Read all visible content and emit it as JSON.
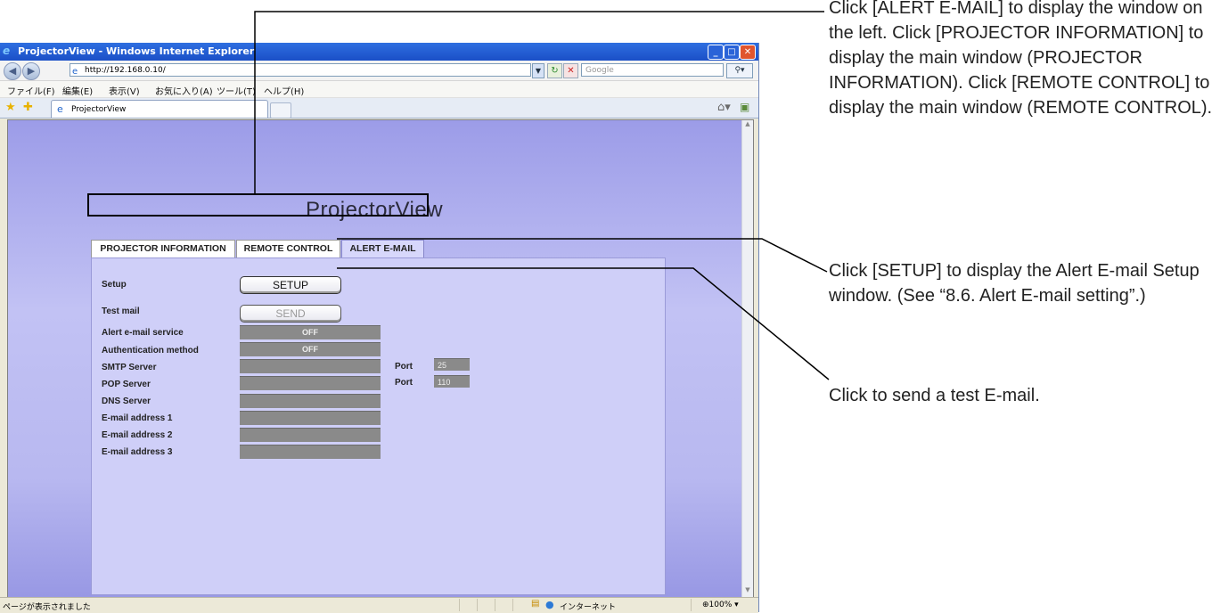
{
  "browser": {
    "title": "ProjectorView - Windows Internet Explorer",
    "url": "http://192.168.0.10/",
    "search_placeholder": "Google",
    "menu": [
      "ファイル(F)",
      "編集(E)",
      "表示(V)",
      "お気に入り(A)",
      "ツール(T)",
      "ヘルプ(H)"
    ],
    "tab_label": "ProjectorView",
    "status_text": "ページが表示されました",
    "zone_text": "インターネット",
    "zoom_text": "100%"
  },
  "app": {
    "title": "ProjectorView",
    "tabs": [
      {
        "label": "PROJECTOR INFORMATION",
        "selected": false
      },
      {
        "label": "REMOTE CONTROL",
        "selected": false
      },
      {
        "label": "ALERT E-MAIL",
        "selected": true
      }
    ],
    "setup_label": "Setup",
    "setup_button": "SETUP",
    "testmail_label": "Test mail",
    "send_button": "SEND",
    "fields": {
      "alert_service": {
        "label": "Alert e-mail service",
        "value": "OFF"
      },
      "auth_method": {
        "label": "Authentication method",
        "value": "OFF"
      },
      "smtp": {
        "label": "SMTP Server",
        "value": "",
        "port_label": "Port",
        "port": "25"
      },
      "pop": {
        "label": "POP Server",
        "value": "",
        "port_label": "Port",
        "port": "110"
      },
      "dns": {
        "label": "DNS Server",
        "value": ""
      },
      "email1": {
        "label": "E-mail address 1",
        "value": ""
      },
      "email2": {
        "label": "E-mail address 2",
        "value": ""
      },
      "email3": {
        "label": "E-mail address 3",
        "value": ""
      }
    }
  },
  "annotations": {
    "alert_tab": "Click [ALERT E-MAIL] to display the window on the left. Click [PROJECTOR INFORMATION] to display the main window (PROJECTOR INFORMATION). Click [REMOTE CONTROL] to display the main window (REMOTE CONTROL).",
    "setup": "Click [SETUP] to display the Alert E-mail Setup window. (See “8.6. Alert E-mail setting”.)",
    "send": "Click to send a test E-mail."
  },
  "colors": {
    "panel": "#cfcff8",
    "selected_tab": "#d7d7fb",
    "value_box": "#8a8a8a"
  }
}
